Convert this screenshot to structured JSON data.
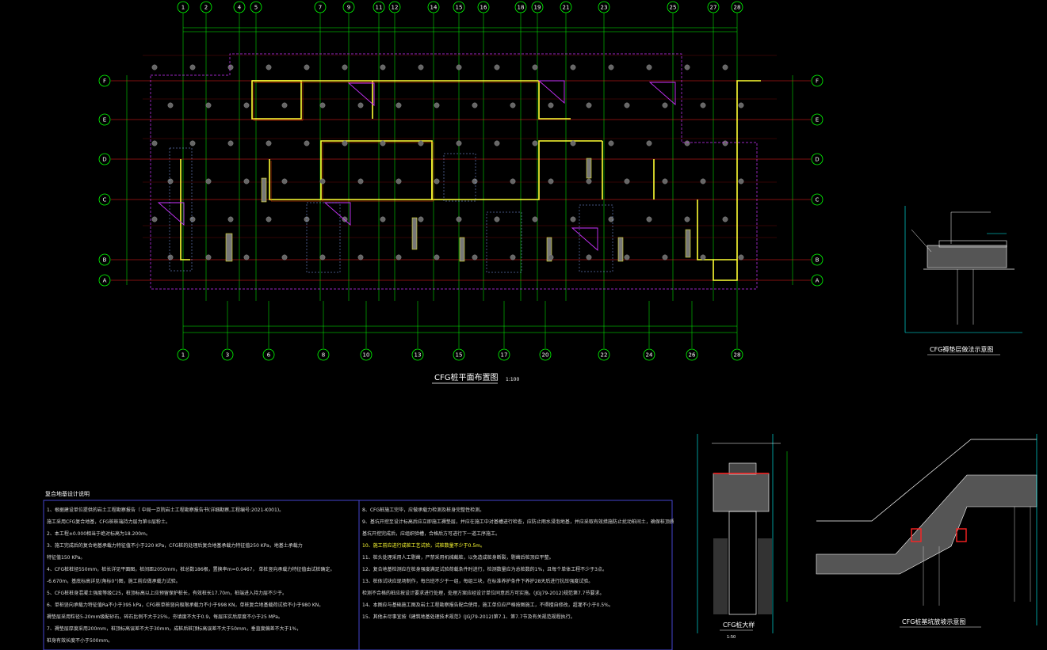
{
  "plan": {
    "title": "CFG桩平面布置图",
    "scale": "1:100",
    "axes_top": [
      "1",
      "2",
      "4",
      "5",
      "7",
      "9",
      "11",
      "12",
      "14",
      "15",
      "16",
      "18",
      "19",
      "21",
      "23",
      "25",
      "27",
      "28"
    ],
    "axes_bottom": [
      "1",
      "3",
      "6",
      "8",
      "10",
      "13",
      "15",
      "17",
      "20",
      "22",
      "24",
      "26",
      "28"
    ],
    "axes_rows": [
      "F",
      "E",
      "D",
      "C",
      "B",
      "A"
    ]
  },
  "details": {
    "cushion_title": "CFG褥垫层做法示意图",
    "pile_title": "CFG桩大样",
    "pile_scale": "1:50",
    "slope_title": "CFG桩基坑放坡示意图"
  },
  "notes": {
    "title": "复合地基设计说明",
    "left": [
      "1、根据建设单位提供的岩土工程勘察报告（                    中局一京院岩土工程勘察报告书(详细勘察,工程编号:2021-K001)。",
      "   施工采用CFG复合地基，CFG桩桩端持力层为第⑤层粉土。",
      "2、本工程±0.000相当于绝对标高为18.200m。",
      "3、施工完成后的复合地基承载力特征值不小于220 KPa，CFG桩的处理后复合地基承载力特征值250 KPa，地基土承载力",
      "   特征值150 KPa。",
      "4、CFG桩桩径550mm，桩长详见平面图，桩间距2050mm，桩总数186根，置换率m=0.0467，         单桩竖向承载力特征值由试桩确定。",
      "   -6.670m，基底标高详见(角标0°)图，施工前应做承载力试验。",
      "5、CFG桩桩身混凝土强度等级C25，桩顶标高以上应预留保护桩长，有效桩长17.70m，桩端进入持力层不少于。",
      "6、单桩竖向承载力特征值Ra不小于395 kPa，CFG桩单桩竖向极限承载力不小于998 KN，单桩复合地基载荷试验不小于980 KN，",
      "   褥垫层采用粒径5-20mm级配砂石，碎石比例不大于25%，夯填度不大于0.9，每层压实后厚度不小于25 MPa。",
      "7、褥垫层厚度采用200mm，桩顶标高误差不大于30mm，成桩后桩顶标高误差不大于50mm，垂直度偏差不大于1%，",
      "   桩身有效长度不小于500mm。"
    ],
    "right": [
      "8、CFG桩施工完毕，应做承载力检测及桩身完整性检测。",
      "9、基坑开挖至设计标高后应立即施工褥垫层，并应在施工中对基槽进行检查，应防止雨水浸泡地基，并应采取有效措施防止扰动桩间土，确保桩顶质量。",
      "   基坑开挖完成后，应组织验槽，合格后方可进行下一道工序施工。",
      "10、施工前应进行成桩工艺试验，试桩数量不少于0.5m。",
      "11、桩头处理采用人工剔凿，严禁采用机械截桩，以免造成桩身断裂，剔凿后桩顶应平整。",
      "12、复合地基检测应在桩身强度满足试验荷载条件时进行，检测数量应为总桩数的1%，且每个单体工程不少于3点。",
      "13、桩体试块应现场制作，每台班不少于一组，每组三块，在标准养护条件下养护28天后进行抗压强度试验。",
      "   检测不合格的桩应按设计要求进行处理，处理方案应经设计单位同意后方可实施。(JGJ79-2012)规范第7.7节要求。",
      "14、本图应与基础施工图及岩土工程勘察报告配合使用，施工单位应严格按图施工，不得擅自修改，超灌不小于0.5%。",
      "15、其他未尽事宜按《建筑地基处理技术规范》(JGJ79-2012)第7.1、第7.7节及有关规范规程执行。"
    ],
    "highlight_index": 3
  },
  "colors": {
    "grid": "#00ff00",
    "axis_line": "#ff2222",
    "wall": "#ffff33",
    "pile": "#666666",
    "magenta": "#cc33ff",
    "border": "#5555ff",
    "cyan": "#00ffff"
  }
}
